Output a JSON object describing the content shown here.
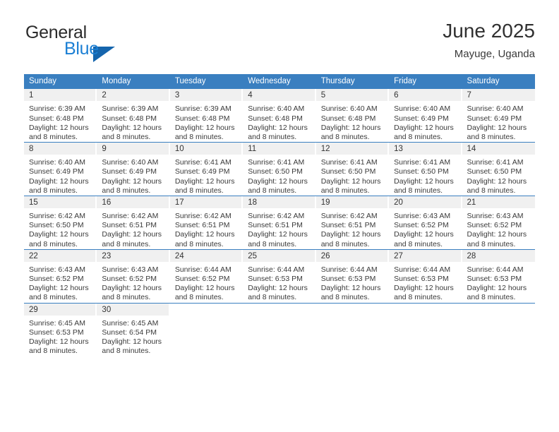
{
  "brand": {
    "name_part1": "General",
    "name_part2": "Blue",
    "triangle_color": "#1565ad",
    "blue_color": "#1b7fd4"
  },
  "header": {
    "month_title": "June 2025",
    "location": "Mayuge, Uganda"
  },
  "theme": {
    "header_row_bg": "#3a7fc0",
    "day_band_bg": "#f0f0f0",
    "text_color": "#3a3a3a"
  },
  "calendar": {
    "weekday_headers": [
      "Sunday",
      "Monday",
      "Tuesday",
      "Wednesday",
      "Thursday",
      "Friday",
      "Saturday"
    ],
    "weeks": [
      [
        {
          "day": "1",
          "sunrise": "Sunrise: 6:39 AM",
          "sunset": "Sunset: 6:48 PM",
          "daylight_line1": "Daylight: 12 hours",
          "daylight_line2": "and 8 minutes."
        },
        {
          "day": "2",
          "sunrise": "Sunrise: 6:39 AM",
          "sunset": "Sunset: 6:48 PM",
          "daylight_line1": "Daylight: 12 hours",
          "daylight_line2": "and 8 minutes."
        },
        {
          "day": "3",
          "sunrise": "Sunrise: 6:39 AM",
          "sunset": "Sunset: 6:48 PM",
          "daylight_line1": "Daylight: 12 hours",
          "daylight_line2": "and 8 minutes."
        },
        {
          "day": "4",
          "sunrise": "Sunrise: 6:40 AM",
          "sunset": "Sunset: 6:48 PM",
          "daylight_line1": "Daylight: 12 hours",
          "daylight_line2": "and 8 minutes."
        },
        {
          "day": "5",
          "sunrise": "Sunrise: 6:40 AM",
          "sunset": "Sunset: 6:48 PM",
          "daylight_line1": "Daylight: 12 hours",
          "daylight_line2": "and 8 minutes."
        },
        {
          "day": "6",
          "sunrise": "Sunrise: 6:40 AM",
          "sunset": "Sunset: 6:49 PM",
          "daylight_line1": "Daylight: 12 hours",
          "daylight_line2": "and 8 minutes."
        },
        {
          "day": "7",
          "sunrise": "Sunrise: 6:40 AM",
          "sunset": "Sunset: 6:49 PM",
          "daylight_line1": "Daylight: 12 hours",
          "daylight_line2": "and 8 minutes."
        }
      ],
      [
        {
          "day": "8",
          "sunrise": "Sunrise: 6:40 AM",
          "sunset": "Sunset: 6:49 PM",
          "daylight_line1": "Daylight: 12 hours",
          "daylight_line2": "and 8 minutes."
        },
        {
          "day": "9",
          "sunrise": "Sunrise: 6:40 AM",
          "sunset": "Sunset: 6:49 PM",
          "daylight_line1": "Daylight: 12 hours",
          "daylight_line2": "and 8 minutes."
        },
        {
          "day": "10",
          "sunrise": "Sunrise: 6:41 AM",
          "sunset": "Sunset: 6:49 PM",
          "daylight_line1": "Daylight: 12 hours",
          "daylight_line2": "and 8 minutes."
        },
        {
          "day": "11",
          "sunrise": "Sunrise: 6:41 AM",
          "sunset": "Sunset: 6:50 PM",
          "daylight_line1": "Daylight: 12 hours",
          "daylight_line2": "and 8 minutes."
        },
        {
          "day": "12",
          "sunrise": "Sunrise: 6:41 AM",
          "sunset": "Sunset: 6:50 PM",
          "daylight_line1": "Daylight: 12 hours",
          "daylight_line2": "and 8 minutes."
        },
        {
          "day": "13",
          "sunrise": "Sunrise: 6:41 AM",
          "sunset": "Sunset: 6:50 PM",
          "daylight_line1": "Daylight: 12 hours",
          "daylight_line2": "and 8 minutes."
        },
        {
          "day": "14",
          "sunrise": "Sunrise: 6:41 AM",
          "sunset": "Sunset: 6:50 PM",
          "daylight_line1": "Daylight: 12 hours",
          "daylight_line2": "and 8 minutes."
        }
      ],
      [
        {
          "day": "15",
          "sunrise": "Sunrise: 6:42 AM",
          "sunset": "Sunset: 6:50 PM",
          "daylight_line1": "Daylight: 12 hours",
          "daylight_line2": "and 8 minutes."
        },
        {
          "day": "16",
          "sunrise": "Sunrise: 6:42 AM",
          "sunset": "Sunset: 6:51 PM",
          "daylight_line1": "Daylight: 12 hours",
          "daylight_line2": "and 8 minutes."
        },
        {
          "day": "17",
          "sunrise": "Sunrise: 6:42 AM",
          "sunset": "Sunset: 6:51 PM",
          "daylight_line1": "Daylight: 12 hours",
          "daylight_line2": "and 8 minutes."
        },
        {
          "day": "18",
          "sunrise": "Sunrise: 6:42 AM",
          "sunset": "Sunset: 6:51 PM",
          "daylight_line1": "Daylight: 12 hours",
          "daylight_line2": "and 8 minutes."
        },
        {
          "day": "19",
          "sunrise": "Sunrise: 6:42 AM",
          "sunset": "Sunset: 6:51 PM",
          "daylight_line1": "Daylight: 12 hours",
          "daylight_line2": "and 8 minutes."
        },
        {
          "day": "20",
          "sunrise": "Sunrise: 6:43 AM",
          "sunset": "Sunset: 6:52 PM",
          "daylight_line1": "Daylight: 12 hours",
          "daylight_line2": "and 8 minutes."
        },
        {
          "day": "21",
          "sunrise": "Sunrise: 6:43 AM",
          "sunset": "Sunset: 6:52 PM",
          "daylight_line1": "Daylight: 12 hours",
          "daylight_line2": "and 8 minutes."
        }
      ],
      [
        {
          "day": "22",
          "sunrise": "Sunrise: 6:43 AM",
          "sunset": "Sunset: 6:52 PM",
          "daylight_line1": "Daylight: 12 hours",
          "daylight_line2": "and 8 minutes."
        },
        {
          "day": "23",
          "sunrise": "Sunrise: 6:43 AM",
          "sunset": "Sunset: 6:52 PM",
          "daylight_line1": "Daylight: 12 hours",
          "daylight_line2": "and 8 minutes."
        },
        {
          "day": "24",
          "sunrise": "Sunrise: 6:44 AM",
          "sunset": "Sunset: 6:52 PM",
          "daylight_line1": "Daylight: 12 hours",
          "daylight_line2": "and 8 minutes."
        },
        {
          "day": "25",
          "sunrise": "Sunrise: 6:44 AM",
          "sunset": "Sunset: 6:53 PM",
          "daylight_line1": "Daylight: 12 hours",
          "daylight_line2": "and 8 minutes."
        },
        {
          "day": "26",
          "sunrise": "Sunrise: 6:44 AM",
          "sunset": "Sunset: 6:53 PM",
          "daylight_line1": "Daylight: 12 hours",
          "daylight_line2": "and 8 minutes."
        },
        {
          "day": "27",
          "sunrise": "Sunrise: 6:44 AM",
          "sunset": "Sunset: 6:53 PM",
          "daylight_line1": "Daylight: 12 hours",
          "daylight_line2": "and 8 minutes."
        },
        {
          "day": "28",
          "sunrise": "Sunrise: 6:44 AM",
          "sunset": "Sunset: 6:53 PM",
          "daylight_line1": "Daylight: 12 hours",
          "daylight_line2": "and 8 minutes."
        }
      ],
      [
        {
          "day": "29",
          "sunrise": "Sunrise: 6:45 AM",
          "sunset": "Sunset: 6:53 PM",
          "daylight_line1": "Daylight: 12 hours",
          "daylight_line2": "and 8 minutes."
        },
        {
          "day": "30",
          "sunrise": "Sunrise: 6:45 AM",
          "sunset": "Sunset: 6:54 PM",
          "daylight_line1": "Daylight: 12 hours",
          "daylight_line2": "and 8 minutes."
        },
        {
          "day": "",
          "sunrise": "",
          "sunset": "",
          "daylight_line1": "",
          "daylight_line2": ""
        },
        {
          "day": "",
          "sunrise": "",
          "sunset": "",
          "daylight_line1": "",
          "daylight_line2": ""
        },
        {
          "day": "",
          "sunrise": "",
          "sunset": "",
          "daylight_line1": "",
          "daylight_line2": ""
        },
        {
          "day": "",
          "sunrise": "",
          "sunset": "",
          "daylight_line1": "",
          "daylight_line2": ""
        },
        {
          "day": "",
          "sunrise": "",
          "sunset": "",
          "daylight_line1": "",
          "daylight_line2": ""
        }
      ]
    ]
  }
}
